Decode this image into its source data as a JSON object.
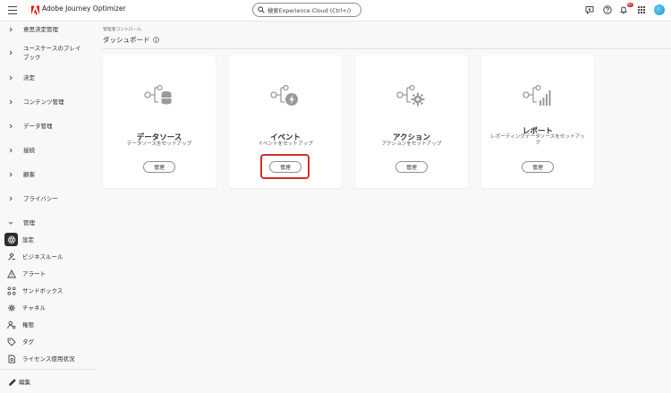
{
  "app": {
    "name": "Adobe Journey Optimizer",
    "brand_color": "#eb1000"
  },
  "header": {
    "search_placeholder": "検索Experience Cloud (Ctrl+/)",
    "notification_count": "9+",
    "icons": [
      "menu-icon",
      "adobe-logo",
      "search-icon",
      "feedback-icon",
      "help-icon",
      "bell-icon",
      "apps-grid-icon",
      "avatar"
    ]
  },
  "sidebar": {
    "groups": [
      {
        "label": "意思決定管理"
      },
      {
        "label": "ユースケースのプレイ\nブック"
      },
      {
        "label": "決定"
      },
      {
        "label": "コンテンツ管理"
      },
      {
        "label": "データ管理"
      },
      {
        "label": "接続"
      },
      {
        "label": "顧客"
      },
      {
        "label": "プライバシー"
      },
      {
        "label": "管理"
      }
    ],
    "admin_items": [
      {
        "label": "設定",
        "icon": "gear-icon",
        "selected": true
      },
      {
        "label": "ビジネスルール",
        "icon": "business-rules-icon"
      },
      {
        "label": "アラート",
        "icon": "alert-icon"
      },
      {
        "label": "サンドボックス",
        "icon": "sandbox-icon"
      },
      {
        "label": "チャネル",
        "icon": "channels-icon"
      },
      {
        "label": "権限",
        "icon": "permissions-icon"
      },
      {
        "label": "タグ",
        "icon": "tag-icon"
      },
      {
        "label": "ライセンス使用状況",
        "icon": "license-icon"
      }
    ],
    "edit_label": "編集"
  },
  "main": {
    "breadcrumb": "管理者コントロール",
    "title": "ダッシュボード",
    "cards": [
      {
        "title": "データソース",
        "description": "データソースをセットアップ",
        "button": "管理",
        "icon": "datasource-icon"
      },
      {
        "title": "イベント",
        "description": "イベントをセットアップ",
        "button": "管理",
        "icon": "event-icon"
      },
      {
        "title": "アクション",
        "description": "アクションをセットアップ",
        "button": "管理",
        "icon": "action-icon"
      },
      {
        "title": "レポート",
        "description": "レポーティングデータソースをセットアップ",
        "button": "管理",
        "icon": "report-icon"
      }
    ]
  }
}
